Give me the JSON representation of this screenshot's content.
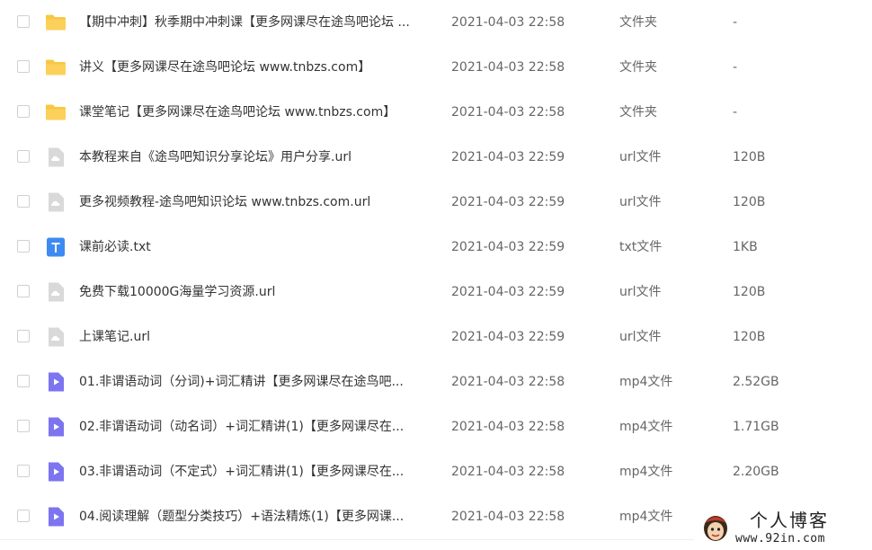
{
  "files": [
    {
      "icon": "folder",
      "name": "【期中冲刺】秋季期中冲刺课【更多网课尽在途鸟吧论坛 ...",
      "time": "2021-04-03 22:58",
      "type": "文件夹",
      "size": "-"
    },
    {
      "icon": "folder",
      "name": "讲义【更多网课尽在途鸟吧论坛 www.tnbzs.com】",
      "time": "2021-04-03 22:58",
      "type": "文件夹",
      "size": "-"
    },
    {
      "icon": "folder",
      "name": "课堂笔记【更多网课尽在途鸟吧论坛 www.tnbzs.com】",
      "time": "2021-04-03 22:58",
      "type": "文件夹",
      "size": "-"
    },
    {
      "icon": "url",
      "name": "本教程来自《途鸟吧知识分享论坛》用户分享.url",
      "time": "2021-04-03 22:59",
      "type": "url文件",
      "size": "120B"
    },
    {
      "icon": "url",
      "name": "更多视频教程-途鸟吧知识论坛 www.tnbzs.com.url",
      "time": "2021-04-03 22:59",
      "type": "url文件",
      "size": "120B"
    },
    {
      "icon": "txt",
      "name": "课前必读.txt",
      "time": "2021-04-03 22:59",
      "type": "txt文件",
      "size": "1KB"
    },
    {
      "icon": "url",
      "name": "免费下载10000G海量学习资源.url",
      "time": "2021-04-03 22:59",
      "type": "url文件",
      "size": "120B"
    },
    {
      "icon": "url",
      "name": "上课笔记.url",
      "time": "2021-04-03 22:59",
      "type": "url文件",
      "size": "120B"
    },
    {
      "icon": "video",
      "name": "01.非谓语动词（分词)+词汇精讲【更多网课尽在途鸟吧...",
      "time": "2021-04-03 22:58",
      "type": "mp4文件",
      "size": "2.52GB"
    },
    {
      "icon": "video",
      "name": "02.非谓语动词（动名词）+词汇精讲(1)【更多网课尽在...",
      "time": "2021-04-03 22:58",
      "type": "mp4文件",
      "size": "1.71GB"
    },
    {
      "icon": "video",
      "name": "03.非谓语动词（不定式）+词汇精讲(1)【更多网课尽在...",
      "time": "2021-04-03 22:58",
      "type": "mp4文件",
      "size": "2.20GB"
    },
    {
      "icon": "video",
      "name": "04.阅读理解（题型分类技巧）+语法精炼(1)【更多网课...",
      "time": "2021-04-03 22:58",
      "type": "mp4文件",
      "size": ""
    }
  ],
  "watermark": {
    "title": "个人博客",
    "url": "www.92in.com"
  },
  "colors": {
    "folder": "#f8c743",
    "url_icon": "#d9d9d9",
    "txt_icon": "#3d8bf2",
    "video_icon": "#7c74f0"
  }
}
